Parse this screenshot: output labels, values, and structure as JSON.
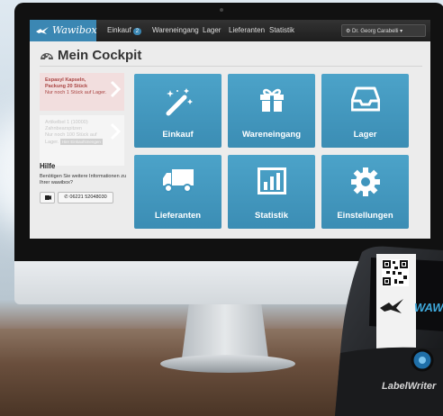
{
  "app": {
    "brand": "Wawibox",
    "nav": [
      {
        "label": "Einkauf",
        "badge": "2"
      },
      {
        "label": "Wareneingang"
      },
      {
        "label": "Lager"
      },
      {
        "label": "Lieferanten"
      },
      {
        "label": "Statistik"
      }
    ],
    "user_menu": "⚙ Dr. Georg Carabelli ▾"
  },
  "page": {
    "title": "Mein Cockpit"
  },
  "notices": [
    {
      "lines": [
        "Espasyl Kapseln,",
        "Packung 20 Stück",
        "Nur noch 1 Stück auf Lager."
      ]
    },
    {
      "lines": [
        "Artikelbel 1 (10000)",
        "Zahnbearspitzen",
        "Nur noch 100 Stück auf",
        "Lager."
      ],
      "tag": "Hier Einkaufsmengen"
    }
  ],
  "help": {
    "title": "Hilfe",
    "text": "Benötigen Sie weitere Informationen zu Ihrer wawibox?",
    "phone": "06221 52048030"
  },
  "tiles": [
    {
      "label": "Einkauf",
      "icon": "magic-wand-icon"
    },
    {
      "label": "Wareneingang",
      "icon": "gift-icon"
    },
    {
      "label": "Lager",
      "icon": "inbox-tray-icon"
    },
    {
      "label": "Lieferanten",
      "icon": "truck-icon"
    },
    {
      "label": "Statistik",
      "icon": "bar-chart-icon"
    },
    {
      "label": "Einstellungen",
      "icon": "gear-icon"
    }
  ],
  "printer": {
    "brand": "LabelWriter",
    "label_text": "WAWIBOX"
  },
  "colors": {
    "tile": "#3b8db4",
    "brand": "#3b87b3",
    "alert_bg": "#f2dede",
    "alert_text": "#a94442"
  }
}
